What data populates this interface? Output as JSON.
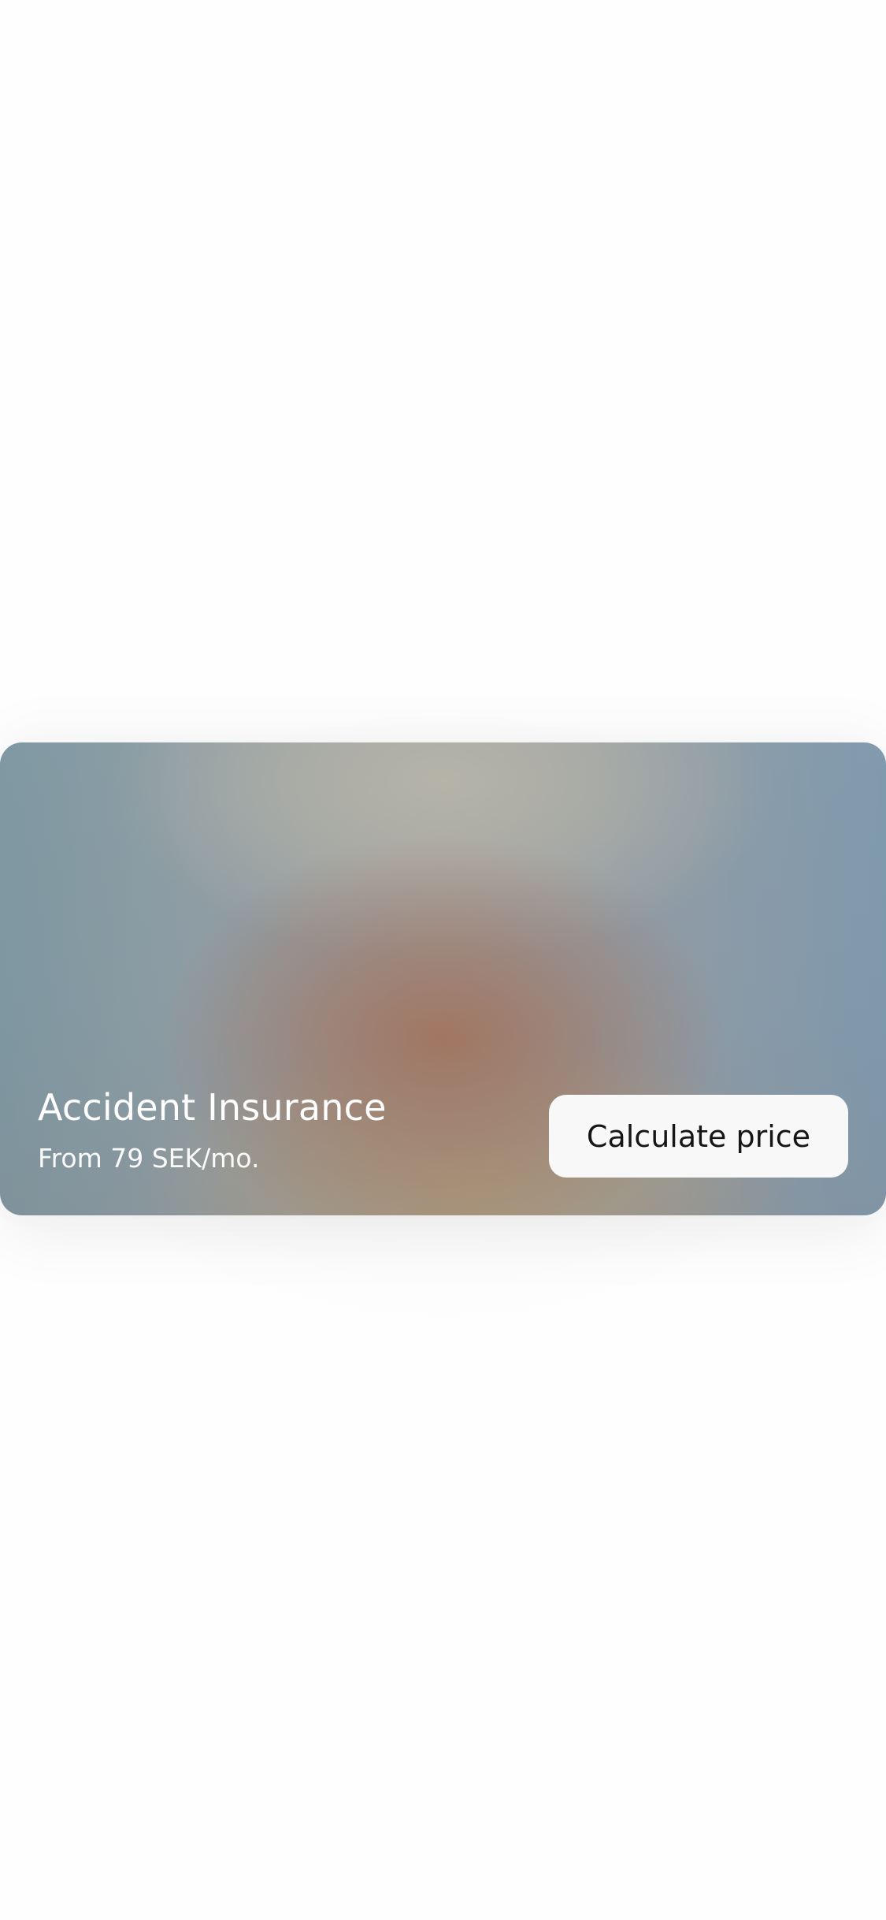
{
  "card": {
    "title": "Accident Insurance",
    "subtitle": "From 79 SEK/mo.",
    "cta_label": "Calculate price"
  },
  "colors": {
    "background": "#fefefe",
    "card_blue": "#7f9aae",
    "card_terracotta": "#a4745c",
    "card_sand": "#b9a078",
    "button_bg": "#f8f8f8",
    "button_text": "#161616",
    "card_text": "#ffffff"
  }
}
